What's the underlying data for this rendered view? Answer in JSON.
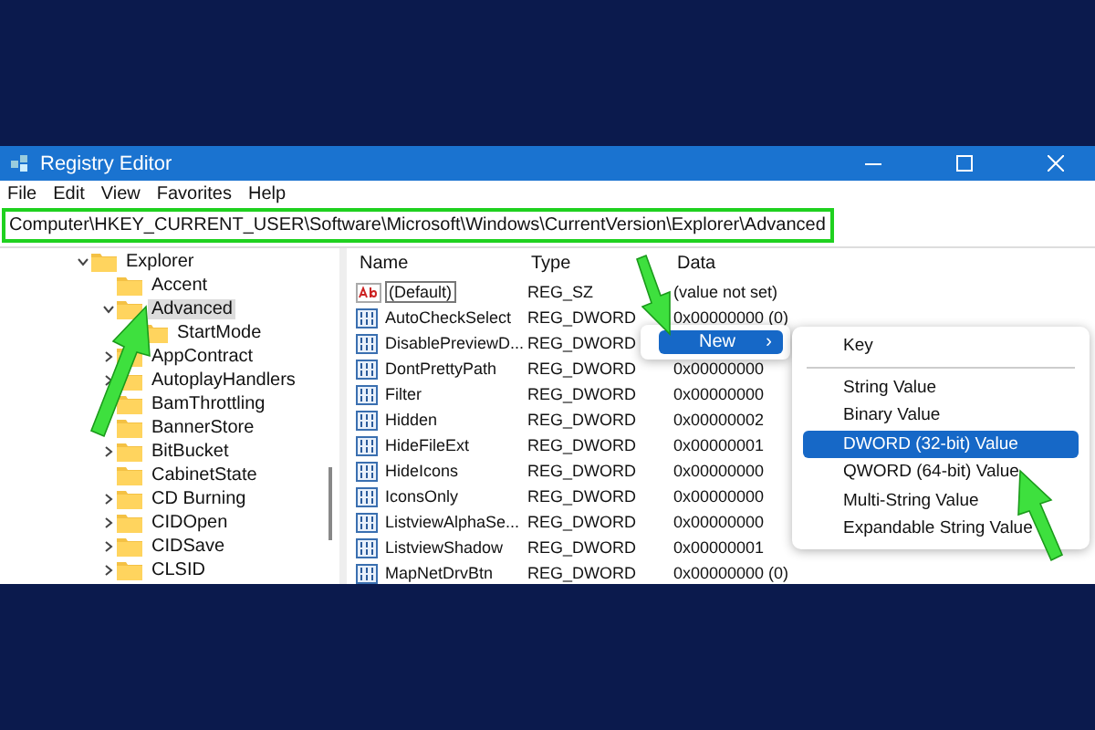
{
  "window": {
    "title": "Registry Editor"
  },
  "menu": [
    "File",
    "Edit",
    "View",
    "Favorites",
    "Help"
  ],
  "address": "Computer\\HKEY_CURRENT_USER\\Software\\Microsoft\\Windows\\CurrentVersion\\Explorer\\Advanced",
  "tree": [
    {
      "label": "Explorer",
      "expanded": true,
      "selected": false,
      "children": [
        {
          "label": "Accent",
          "selected": false
        },
        {
          "label": "Advanced",
          "expanded": true,
          "selected": true,
          "children": [
            {
              "label": "StartMode",
              "selected": false
            }
          ]
        },
        {
          "label": "AppContract",
          "expanded": false,
          "selected": false
        },
        {
          "label": "AutoplayHandlers",
          "expanded": false,
          "selected": false
        },
        {
          "label": "BamThrottling",
          "selected": false
        },
        {
          "label": "BannerStore",
          "selected": false
        },
        {
          "label": "BitBucket",
          "expanded": false,
          "selected": false
        },
        {
          "label": "CabinetState",
          "selected": false
        },
        {
          "label": "CD Burning",
          "expanded": false,
          "selected": false
        },
        {
          "label": "CIDOpen",
          "expanded": false,
          "selected": false
        },
        {
          "label": "CIDSave",
          "expanded": false,
          "selected": false
        },
        {
          "label": "CLSID",
          "expanded": false,
          "selected": false
        }
      ]
    }
  ],
  "table": {
    "columns": [
      "Name",
      "Type",
      "Data"
    ],
    "rows": [
      {
        "kind": "string",
        "name": "(Default)",
        "type": "REG_SZ",
        "data": "(value not set)",
        "selected": true
      },
      {
        "kind": "dword",
        "name": "AutoCheckSelect",
        "type": "REG_DWORD",
        "data": "0x00000000 (0)",
        "selected": false
      },
      {
        "kind": "dword",
        "name": "DisablePreviewD...",
        "type": "REG_DWORD",
        "selected": false
      },
      {
        "kind": "dword",
        "name": "DontPrettyPath",
        "type": "REG_DWORD",
        "data": "0x00000000",
        "selected": false
      },
      {
        "kind": "dword",
        "name": "Filter",
        "type": "REG_DWORD",
        "data": "0x00000000",
        "selected": false
      },
      {
        "kind": "dword",
        "name": "Hidden",
        "type": "REG_DWORD",
        "data": "0x00000002",
        "selected": false
      },
      {
        "kind": "dword",
        "name": "HideFileExt",
        "type": "REG_DWORD",
        "data": "0x00000001",
        "selected": false
      },
      {
        "kind": "dword",
        "name": "HideIcons",
        "type": "REG_DWORD",
        "data": "0x00000000",
        "selected": false
      },
      {
        "kind": "dword",
        "name": "IconsOnly",
        "type": "REG_DWORD",
        "data": "0x00000000",
        "selected": false
      },
      {
        "kind": "dword",
        "name": "ListviewAlphaSe...",
        "type": "REG_DWORD",
        "data": "0x00000000",
        "selected": false
      },
      {
        "kind": "dword",
        "name": "ListviewShadow",
        "type": "REG_DWORD",
        "data": "0x00000001",
        "selected": false
      },
      {
        "kind": "dword",
        "name": "MapNetDrvBtn",
        "type": "REG_DWORD",
        "data": "0x00000000 (0)",
        "selected": false
      }
    ]
  },
  "context_menu": {
    "items": [
      {
        "label": "New",
        "arrow": "›",
        "selected": true
      }
    ]
  },
  "submenu": {
    "items": [
      {
        "label": "Key",
        "selected": false
      },
      {
        "label": "String Value",
        "selected": false
      },
      {
        "label": "Binary Value",
        "selected": false
      },
      {
        "label": "DWORD (32-bit) Value",
        "selected": true
      },
      {
        "label": "QWORD (64-bit) Value",
        "selected": false
      },
      {
        "label": "Multi-String Value",
        "selected": false
      },
      {
        "label": "Expandable String Value",
        "selected": false
      }
    ]
  }
}
